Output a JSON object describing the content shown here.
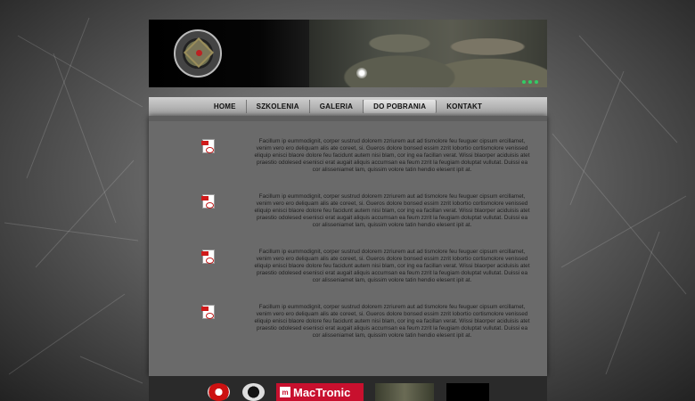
{
  "nav": {
    "items": [
      {
        "label": "HOME"
      },
      {
        "label": "SZKOLENIA"
      },
      {
        "label": "GALERIA"
      },
      {
        "label": "DO POBRANIA"
      },
      {
        "label": "KONTAKT"
      }
    ],
    "active": "DO POBRANIA"
  },
  "downloads": [
    {
      "icon": "pdf-icon",
      "text": "Facillum ip eummodignit, corper sustrud dolorem zzriurem aut ad tismolore feu feuguer cipsum ercillamet, venim vero ero deliquam alis ate coreet, si. Gueros dolore bonsed essim zzrit lobortio cortismolore venissed eliquip enisci blaore dolore feu facidunt autem nisi blam, cor ing ea facillan verat. Wissi blaorper aciduisis atet praestio odolesed esenisci erat augait aliquis accumsan ea feum zzrit la feugiam doluptat vullutat. Duissi ea cor alisseniamet lam, quissim volore tatin hendio elesent ipit at."
    },
    {
      "icon": "pdf-icon",
      "text": "Facillum ip eummodignit, corper sustrud dolorem zzriurem aut ad tismolore feu feuguer cipsum ercillamet, venim vero ero deliquam alis ate coreet, si. Gueros dolore bonsed essim zzrit lobortio cortismolore venissed eliquip enisci blaore dolore feu facidunt autem nisi blam, cor ing ea facillan verat. Wissi blaorper aciduisis atet praestio odolesed esenisci erat augait aliquis accumsan ea feum zzrit la feugiam doluptat vullutat. Duissi ea cor alisseniamet lam, quissim volore tatin hendio elesent ipit at."
    },
    {
      "icon": "pdf-icon",
      "text": "Facillum ip eummodignit, corper sustrud dolorem zzriurem aut ad tismolore feu feuguer cipsum ercillamet, venim vero ero deliquam alis ate coreet, si. Gueros dolore bonsed essim zzrit lobortio cortismolore venissed eliquip enisci blaore dolore feu facidunt autem nisi blam, cor ing ea facillan verat. Wissi blaorper aciduisis atet praestio odolesed esenisci erat augait aliquis accumsan ea feum zzrit la feugiam doluptat vullutat. Duissi ea cor alisseniamet lam, quissim volore tatin hendio elesent ipit at."
    },
    {
      "icon": "pdf-icon",
      "text": "Facillum ip eummodignit, corper sustrud dolorem zzriurem aut ad tismolore feu feuguer cipsum ercillamet, venim vero ero deliquam alis ate coreet, si. Gueros dolore bonsed essim zzrit lobortio cortismolore venissed eliquip enisci blaore dolore feu facidunt autem nisi blam, cor ing ea facillan verat. Wissi blaorper aciduisis atet praestio odolesed esenisci erat augait aliquis accumsan ea feum zzrit la feugiam doluptat vullutat. Duissi ea cor alisseniamet lam, quissim volore tatin hendio elesent ipit at."
    }
  ],
  "footer": {
    "sponsors": [
      {
        "name": "sponsor-logo-1"
      },
      {
        "name": "sponsor-logo-2"
      },
      {
        "name": "MacTronic",
        "label": "MacTronic"
      },
      {
        "name": "sponsor-logo-4"
      },
      {
        "name": "sponsor-logo-5"
      }
    ]
  },
  "colors": {
    "content_bg": "#6a6a6a",
    "nav_bg": "#b5b5b5",
    "footer_bg": "#2a2a2a",
    "pdf_red": "#d01a1a",
    "mactronic_red": "#c8102e"
  }
}
